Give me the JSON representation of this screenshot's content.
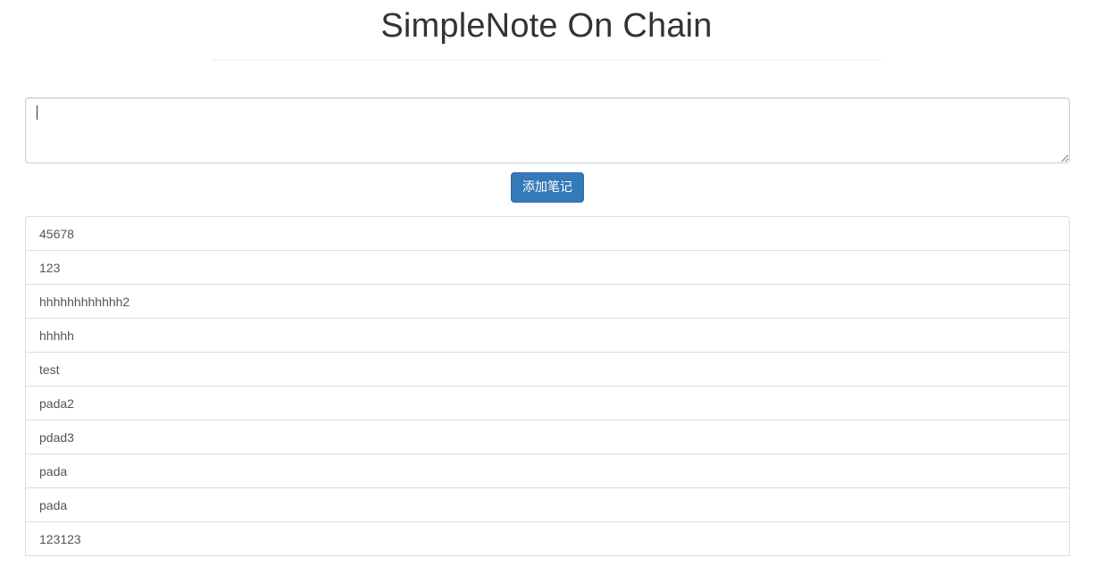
{
  "header": {
    "title": "SimpleNote On Chain"
  },
  "editor": {
    "value": "",
    "placeholder": ""
  },
  "actions": {
    "add_label": "添加笔记"
  },
  "notes": [
    "45678",
    "123",
    "hhhhhhhhhhhh2",
    "hhhhh",
    "test",
    "pada2",
    "pdad3",
    "pada",
    "pada",
    "123123"
  ],
  "colors": {
    "button": "#337ab7",
    "button_border": "#2e6da4",
    "text": "#333333",
    "list_border": "#dddddd"
  }
}
